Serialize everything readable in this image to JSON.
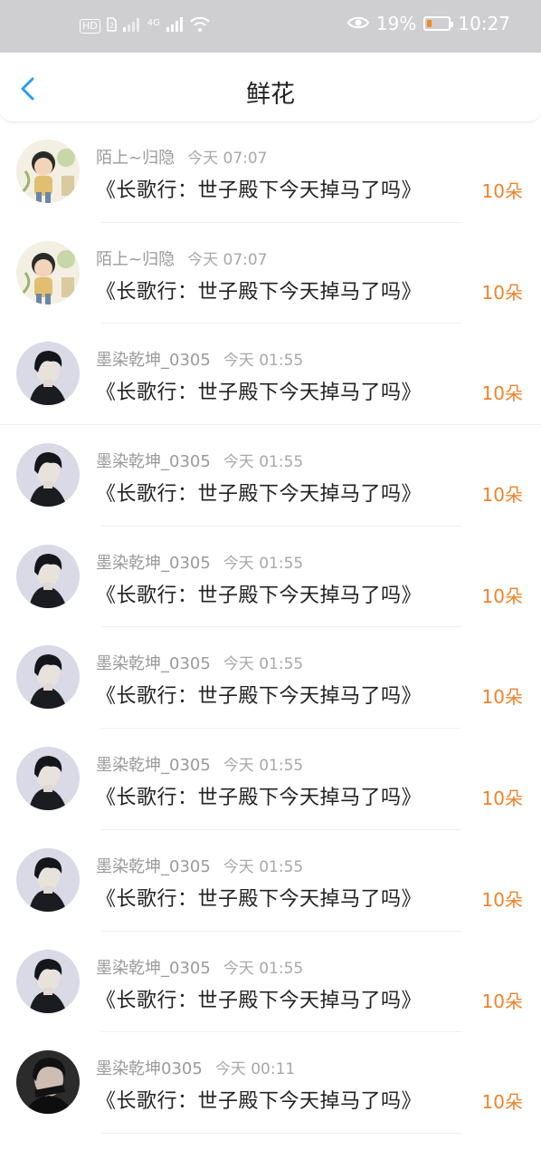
{
  "status_bar": {
    "hd": "HD",
    "net": "4G",
    "battery_percent": 19,
    "battery_text": "19%",
    "time": "10:27",
    "icons": [
      "sim-icon",
      "signal-icon",
      "wifi-icon",
      "eye-icon",
      "battery-icon"
    ]
  },
  "header": {
    "title": "鲜花",
    "back_icon": "chevron-left-icon"
  },
  "colors": {
    "accent_blue": "#2a9df4",
    "count_orange": "#f0832a"
  },
  "items": [
    {
      "user": "陌上~归隐",
      "time": "今天 07:07",
      "title": "《长歌行：世子殿下今天掉马了吗》",
      "count": "10朵",
      "avatar": "illustration-avatar"
    },
    {
      "user": "陌上~归隐",
      "time": "今天 07:07",
      "title": "《长歌行：世子殿下今天掉马了吗》",
      "count": "10朵",
      "avatar": "illustration-avatar"
    },
    {
      "user": "墨染乾坤_0305",
      "time": "今天 01:55",
      "title": "《长歌行：世子殿下今天掉马了吗》",
      "count": "10朵",
      "avatar": "portrait-avatar"
    },
    {
      "user": "墨染乾坤_0305",
      "time": "今天 01:55",
      "title": "《长歌行：世子殿下今天掉马了吗》",
      "count": "10朵",
      "avatar": "portrait-avatar"
    },
    {
      "user": "墨染乾坤_0305",
      "time": "今天 01:55",
      "title": "《长歌行：世子殿下今天掉马了吗》",
      "count": "10朵",
      "avatar": "portrait-avatar"
    },
    {
      "user": "墨染乾坤_0305",
      "time": "今天 01:55",
      "title": "《长歌行：世子殿下今天掉马了吗》",
      "count": "10朵",
      "avatar": "portrait-avatar"
    },
    {
      "user": "墨染乾坤_0305",
      "time": "今天 01:55",
      "title": "《长歌行：世子殿下今天掉马了吗》",
      "count": "10朵",
      "avatar": "portrait-avatar"
    },
    {
      "user": "墨染乾坤_0305",
      "time": "今天 01:55",
      "title": "《长歌行：世子殿下今天掉马了吗》",
      "count": "10朵",
      "avatar": "portrait-avatar"
    },
    {
      "user": "墨染乾坤_0305",
      "time": "今天 01:55",
      "title": "《长歌行：世子殿下今天掉马了吗》",
      "count": "10朵",
      "avatar": "portrait-avatar"
    },
    {
      "user": "墨染乾坤0305",
      "time": "今天 00:11",
      "title": "《长歌行：世子殿下今天掉马了吗》",
      "count": "10朵",
      "avatar": "dark-portrait-avatar"
    }
  ]
}
